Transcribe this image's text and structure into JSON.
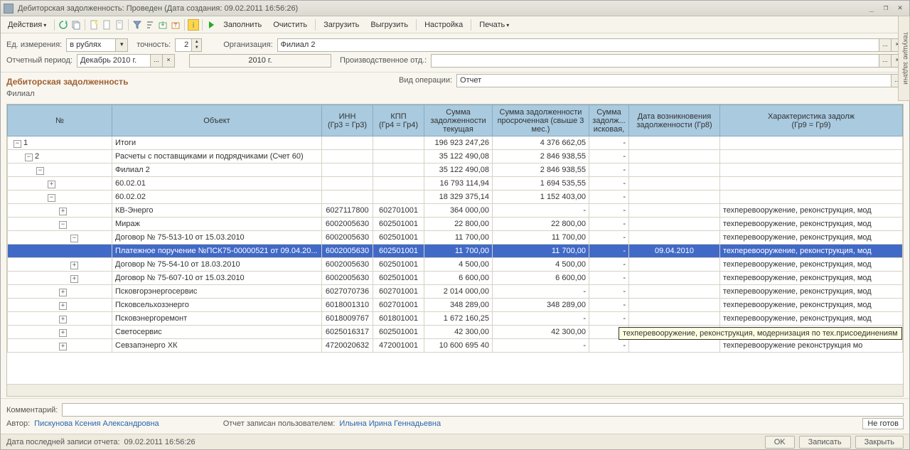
{
  "title": "Дебиторская задолженность: Проведен (Дата создания: 09.02.2011 16:56:26)",
  "toolbar": {
    "actions": "Действия",
    "fill": "Заполнить",
    "clear": "Очистить",
    "load": "Загрузить",
    "unload": "Выгрузить",
    "settings": "Настройка",
    "print": "Печать"
  },
  "fields": {
    "unit_lbl": "Ед. измерения:",
    "unit_val": "в рублях",
    "precision_lbl": "точность:",
    "precision_val": "2",
    "org_lbl": "Организация:",
    "org_val": "Филиал 2",
    "period_lbl": "Отчетный период:",
    "period_val": "Декабрь 2010 г.",
    "year_val": "2010 г.",
    "dept_lbl": "Производственное отд.:",
    "dept_val": "",
    "optype_lbl": "Вид операции:",
    "optype_val": "Отчет"
  },
  "section": "Дебиторская задолженность",
  "filial_lbl": "Филиал",
  "cols": {
    "num": "№",
    "obj": "Объект",
    "inn": "ИНН\n(Гр3 = Гр3)",
    "kpp": "КПП\n(Гр4 = Гр4)",
    "sum_cur": "Сумма задолженности текущая",
    "sum_over": "Сумма задолженности просроченная (свыше 3 мес.)",
    "sum_isk": "Сумма задолж... исковая,",
    "date": "Дата возникновения задолженности (Гр8)",
    "char": "Характеристика задолж\n(Гр9 = Гр9)"
  },
  "rows": [
    {
      "lvl": 0,
      "exp": "-",
      "num": "1",
      "obj": "Итоги",
      "inn": "",
      "kpp": "",
      "s1": "196 923 247,26",
      "s2": "4 376 662,05",
      "s3": "-",
      "d": "",
      "c": ""
    },
    {
      "lvl": 1,
      "exp": "-",
      "num": "2",
      "obj": "Расчеты с поставщиками и подрядчиками (Счет 60)",
      "inn": "",
      "kpp": "",
      "s1": "35 122 490,08",
      "s2": "2 846 938,55",
      "s3": "-",
      "d": "",
      "c": ""
    },
    {
      "lvl": 2,
      "exp": "-",
      "num": "",
      "obj": "Филиал 2",
      "inn": "",
      "kpp": "",
      "s1": "35 122 490,08",
      "s2": "2 846 938,55",
      "s3": "-",
      "d": "",
      "c": ""
    },
    {
      "lvl": 3,
      "exp": "+",
      "num": "",
      "obj": "60.02.01",
      "inn": "",
      "kpp": "",
      "s1": "16 793 114,94",
      "s2": "1 694 535,55",
      "s3": "-",
      "d": "",
      "c": ""
    },
    {
      "lvl": 3,
      "exp": "-",
      "num": "",
      "obj": "60.02.02",
      "inn": "",
      "kpp": "",
      "s1": "18 329 375,14",
      "s2": "1 152 403,00",
      "s3": "-",
      "d": "",
      "c": ""
    },
    {
      "lvl": 4,
      "exp": "+",
      "num": "",
      "obj": "КВ-Энерго",
      "inn": "6027117800",
      "kpp": "602701001",
      "s1": "364 000,00",
      "s2": "-",
      "s3": "-",
      "d": "",
      "c": "техперевооружение, реконструкция, мод"
    },
    {
      "lvl": 4,
      "exp": "-",
      "num": "",
      "obj": "Мираж",
      "inn": "6002005630",
      "kpp": "602501001",
      "s1": "22 800,00",
      "s2": "22 800,00",
      "s3": "-",
      "d": "",
      "c": "техперевооружение, реконструкция, мод"
    },
    {
      "lvl": 5,
      "exp": "-",
      "num": "",
      "obj": "Договор № 75-513-10 от 15.03.2010",
      "inn": "6002005630",
      "kpp": "602501001",
      "s1": "11 700,00",
      "s2": "11 700,00",
      "s3": "-",
      "d": "",
      "c": "техперевооружение, реконструкция, мод"
    },
    {
      "lvl": 6,
      "exp": "",
      "num": "",
      "obj": "Платежное поручение №ПСК75-00000521 от 09.04.20...",
      "inn": "6002005630",
      "kpp": "602501001",
      "s1": "11 700,00",
      "s2": "11 700,00",
      "s3": "-",
      "d": "09.04.2010",
      "c": "техперевооружение, реконструкция, мод",
      "sel": true
    },
    {
      "lvl": 5,
      "exp": "+",
      "num": "",
      "obj": "Договор № 75-54-10 от 18.03.2010",
      "inn": "6002005630",
      "kpp": "602501001",
      "s1": "4 500,00",
      "s2": "4 500,00",
      "s3": "-",
      "d": "",
      "c": "техперевооружение, реконструкция, мод"
    },
    {
      "lvl": 5,
      "exp": "+",
      "num": "",
      "obj": "Договор № 75-607-10 от 15.03.2010",
      "inn": "6002005630",
      "kpp": "602501001",
      "s1": "6 600,00",
      "s2": "6 600,00",
      "s3": "-",
      "d": "",
      "c": "техперевооружение, реконструкция, мод"
    },
    {
      "lvl": 4,
      "exp": "+",
      "num": "",
      "obj": "Псковгорэнергосервис",
      "inn": "6027070736",
      "kpp": "602701001",
      "s1": "2 014 000,00",
      "s2": "-",
      "s3": "-",
      "d": "",
      "c": "техперевооружение, реконструкция, мод"
    },
    {
      "lvl": 4,
      "exp": "+",
      "num": "",
      "obj": "Псковсельхозэнерго",
      "inn": "6018001310",
      "kpp": "602701001",
      "s1": "348 289,00",
      "s2": "348 289,00",
      "s3": "-",
      "d": "",
      "c": "техперевооружение, реконструкция, мод"
    },
    {
      "lvl": 4,
      "exp": "+",
      "num": "",
      "obj": "Псковэнергоремонт",
      "inn": "6018009767",
      "kpp": "601801001",
      "s1": "1 672 160,25",
      "s2": "-",
      "s3": "-",
      "d": "",
      "c": "техперевооружение, реконструкция, мод"
    },
    {
      "lvl": 4,
      "exp": "+",
      "num": "",
      "obj": "Светосервис",
      "inn": "6025016317",
      "kpp": "602501001",
      "s1": "42 300,00",
      "s2": "42 300,00",
      "s3": "-",
      "d": "",
      "c": "техперевооружение, реконструкция, мод"
    },
    {
      "lvl": 4,
      "exp": "+",
      "num": "",
      "obj": "Севзапэнерго ХК",
      "inn": "4720020632",
      "kpp": "472001001",
      "s1": "10 600 695 40",
      "s2": "-",
      "s3": "-",
      "d": "",
      "c": "техперевооружение реконструкция мо"
    }
  ],
  "tooltip": "техперевооружение, реконструкция, модернизация по тех.присоединениям",
  "bottom": {
    "comment_lbl": "Комментарий:",
    "comment_val": "",
    "author_lbl": "Автор:",
    "author_val": "Пискунова Ксения Александровна",
    "saved_lbl": "Отчет записан пользователем:",
    "saved_val": "Ильина Ирина Геннадьевна",
    "status": "Не готов"
  },
  "status": {
    "date_lbl": "Дата последней записи отчета:",
    "date_val": "09.02.2011 16:56:26",
    "ok": "OK",
    "save": "Записать",
    "close": "Закрыть"
  },
  "sidetab": "текущие задачи"
}
